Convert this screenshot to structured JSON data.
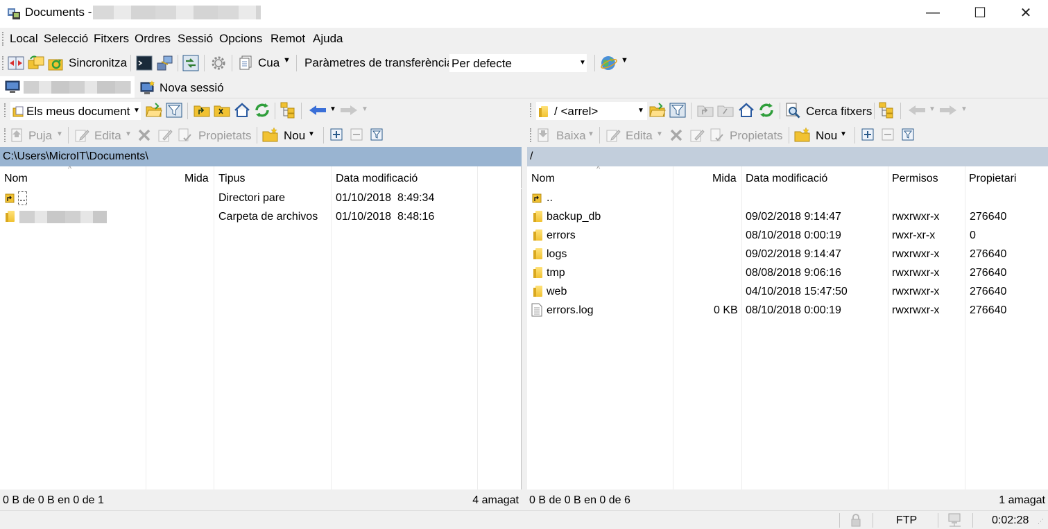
{
  "window": {
    "title": "Documents -",
    "controls": {
      "minimize": "—",
      "maximize": "☐",
      "close": "✕"
    }
  },
  "menu": [
    "Local",
    "Selecció",
    "Fitxers",
    "Ordres",
    "Sessió",
    "Opcions",
    "Remot",
    "Ajuda"
  ],
  "toolbar": {
    "synchronize_label": "Sincronitza",
    "queue_label": "Cua",
    "transfer_params_label": "Paràmetres de transferència",
    "transfer_preset": "Per defecte"
  },
  "tabs": {
    "new_session_label": "Nova sessió"
  },
  "local": {
    "location": "Els meus document",
    "actions": {
      "upload": "Puja",
      "edit": "Edita",
      "properties": "Propietats",
      "new": "Nou"
    },
    "path": "C:\\Users\\MicroIT\\Documents\\",
    "columns": {
      "name": "Nom",
      "size": "Mida",
      "type": "Tipus",
      "modified": "Data modificació"
    },
    "rows": [
      {
        "name": "..",
        "size": "",
        "type": "Directori pare",
        "modified": "01/10/2018  8:49:34"
      },
      {
        "name": "",
        "size": "",
        "type": "Carpeta de archivos",
        "modified": "01/10/2018  8:48:16"
      }
    ],
    "status_left": "0 B de 0 B en 0 de 1",
    "status_right": "4 amagat"
  },
  "remote": {
    "location": "/ <arrel>",
    "find_files_label": "Cerca fitxers",
    "actions": {
      "download": "Baixa",
      "edit": "Edita",
      "properties": "Propietats",
      "new": "Nou"
    },
    "path": "/",
    "columns": {
      "name": "Nom",
      "size": "Mida",
      "modified": "Data modificació",
      "permissions": "Permisos",
      "owner": "Propietari"
    },
    "rows": [
      {
        "name": "..",
        "size": "",
        "modified": "",
        "permissions": "",
        "owner": "",
        "kind": "parent"
      },
      {
        "name": "backup_db",
        "size": "",
        "modified": "09/02/2018 9:14:47",
        "permissions": "rwxrwxr-x",
        "owner": "276640",
        "kind": "folder"
      },
      {
        "name": "errors",
        "size": "",
        "modified": "08/10/2018 0:00:19",
        "permissions": "rwxr-xr-x",
        "owner": "0",
        "kind": "folder"
      },
      {
        "name": "logs",
        "size": "",
        "modified": "09/02/2018 9:14:47",
        "permissions": "rwxrwxr-x",
        "owner": "276640",
        "kind": "folder"
      },
      {
        "name": "tmp",
        "size": "",
        "modified": "08/08/2018 9:06:16",
        "permissions": "rwxrwxr-x",
        "owner": "276640",
        "kind": "folder"
      },
      {
        "name": "web",
        "size": "",
        "modified": "04/10/2018 15:47:50",
        "permissions": "rwxrwxr-x",
        "owner": "276640",
        "kind": "folder"
      },
      {
        "name": "errors.log",
        "size": "0 KB",
        "modified": "08/10/2018 0:00:19",
        "permissions": "rwxrwxr-x",
        "owner": "276640",
        "kind": "file"
      }
    ],
    "status_left": "0 B de 0 B en 0 de 6",
    "status_right": "1 amagat"
  },
  "statusbar": {
    "protocol": "FTP",
    "elapsed": "0:02:28"
  },
  "colors": {
    "chrome": "#f0f0f0",
    "local_path_bg": "#99b4d1",
    "remote_path_bg": "#c2cedc",
    "folder": "#f1c232",
    "arrow_blue": "#3a6fd8",
    "refresh_green": "#2e9e3a"
  }
}
